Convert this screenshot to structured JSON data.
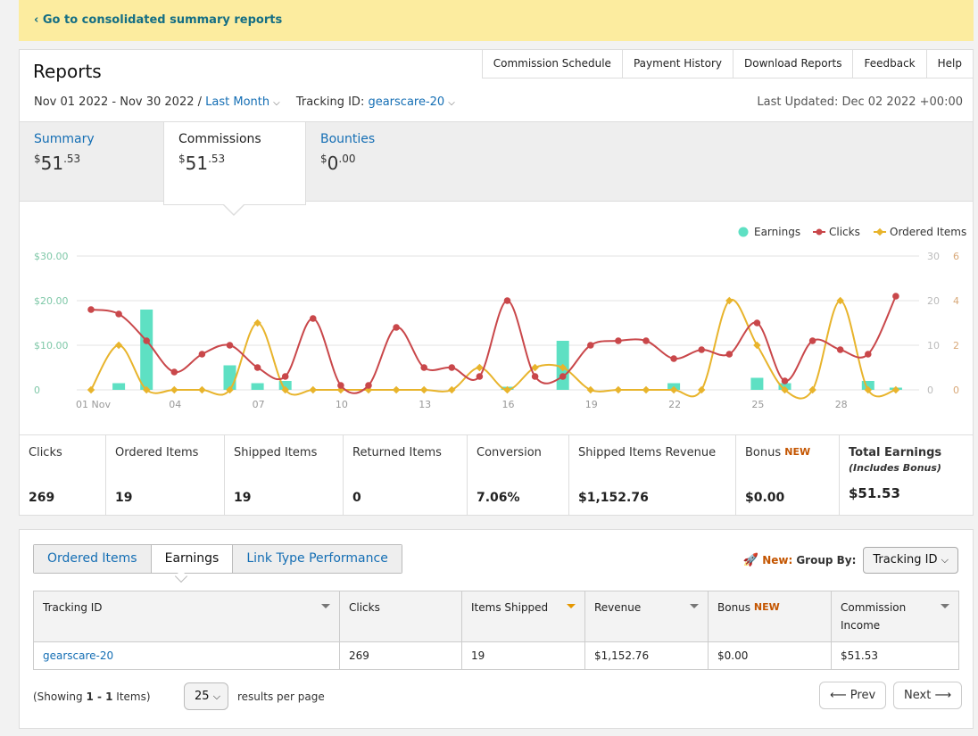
{
  "banner": {
    "link": "‹ Go to consolidated summary reports"
  },
  "reports": {
    "title": "Reports",
    "nav": [
      "Commission Schedule",
      "Payment History",
      "Download Reports",
      "Feedback",
      "Help"
    ],
    "date_range": "Nov 01 2022 - Nov 30 2022 /",
    "period": "Last Month",
    "tracking_label": "Tracking ID:",
    "tracking_id": "gearscare-20",
    "last_updated": "Last Updated: Dec 02 2022 +00:00"
  },
  "tabs": [
    {
      "label": "Summary",
      "currency": "$",
      "whole": "51",
      "cents": ".53"
    },
    {
      "label": "Commissions",
      "currency": "$",
      "whole": "51",
      "cents": ".53"
    },
    {
      "label": "Bounties",
      "currency": "$",
      "whole": "0",
      "cents": ".00"
    }
  ],
  "colors": {
    "earnings": "#5ee0c3",
    "clicks": "#c9474a",
    "ordered": "#e8b42c",
    "link": "#146eb4",
    "new_badge": "#c45500"
  },
  "chart_data": {
    "type": "line",
    "x": [
      "01 Nov",
      "02",
      "03",
      "04",
      "05",
      "06",
      "07",
      "08",
      "09",
      "10",
      "11",
      "12",
      "13",
      "14",
      "15",
      "16",
      "17",
      "18",
      "19",
      "20",
      "21",
      "22",
      "23",
      "24",
      "25",
      "26",
      "27",
      "28",
      "29",
      "30"
    ],
    "x_tick_labels": [
      "01 Nov",
      "04",
      "07",
      "10",
      "13",
      "16",
      "19",
      "22",
      "25",
      "28"
    ],
    "series": [
      {
        "name": "Earnings",
        "type": "bar",
        "axis": "left",
        "values": [
          0,
          1.5,
          18,
          0,
          0,
          5.5,
          1.5,
          2,
          0,
          0,
          0,
          0,
          0,
          0,
          0,
          0.7,
          0,
          11,
          0,
          0,
          0,
          1.5,
          0,
          0,
          2.7,
          1.5,
          0,
          0,
          2,
          0.5
        ]
      },
      {
        "name": "Clicks",
        "type": "line",
        "axis": "right",
        "values": [
          18,
          17,
          11,
          4,
          8,
          10,
          5,
          3,
          16,
          1,
          1,
          14,
          5,
          5,
          3,
          20,
          3,
          3,
          10,
          11,
          11,
          7,
          9,
          8,
          15,
          2,
          11,
          9,
          8,
          21
        ]
      },
      {
        "name": "Ordered Items",
        "type": "line",
        "axis": "right2",
        "values": [
          0,
          2,
          0,
          0,
          0,
          0,
          3,
          0,
          0,
          0,
          0,
          0,
          0,
          0,
          1,
          0,
          1,
          1,
          0,
          0,
          0,
          0,
          0,
          4,
          2,
          0,
          0,
          4,
          0,
          0
        ]
      }
    ],
    "y_left": {
      "ticks": [
        "$30.00",
        "$20.00",
        "$10.00",
        "0"
      ],
      "ylim": [
        0,
        30
      ]
    },
    "y_right": {
      "ticks": [
        "30",
        "20",
        "10",
        "0"
      ],
      "ylim": [
        0,
        30
      ]
    },
    "y_right2": {
      "ticks": [
        "6",
        "4",
        "2",
        "0"
      ],
      "ylim": [
        0,
        6
      ]
    },
    "legend": {
      "placement": "top-right",
      "items": [
        "Earnings",
        "Clicks",
        "Ordered Items"
      ]
    },
    "grid": true
  },
  "stats": [
    {
      "label": "Clicks",
      "value": "269"
    },
    {
      "label": "Ordered Items",
      "value": "19"
    },
    {
      "label": "Shipped Items",
      "value": "19"
    },
    {
      "label": "Returned Items",
      "value": "0"
    },
    {
      "label": "Conversion",
      "value": "7.06%"
    },
    {
      "label": "Shipped Items Revenue",
      "value": "$1,152.76"
    },
    {
      "label": "Bonus",
      "badge": "NEW",
      "value": "$0.00"
    },
    {
      "label": "Total Earnings",
      "sub": "(Includes Bonus)",
      "value": "$51.53"
    }
  ],
  "report_tabs": [
    "Ordered Items",
    "Earnings",
    "Link Type Performance"
  ],
  "group_by": {
    "new_label": "New:",
    "label": "Group By:",
    "selected": "Tracking ID"
  },
  "table": {
    "headers": [
      "Tracking ID",
      "Clicks",
      "Items Shipped",
      "Revenue",
      "Bonus",
      "Commission Income"
    ],
    "header_badge": "NEW",
    "rows": [
      [
        "gearscare-20",
        "269",
        "19",
        "$1,152.76",
        "$0.00",
        "$51.53"
      ]
    ]
  },
  "pagination": {
    "showing_prefix": "(Showing ",
    "showing_range": "1 - 1",
    "showing_suffix": " Items)",
    "per_page": "25",
    "per_page_label": "results per page",
    "prev": "Prev",
    "next": "Next"
  }
}
